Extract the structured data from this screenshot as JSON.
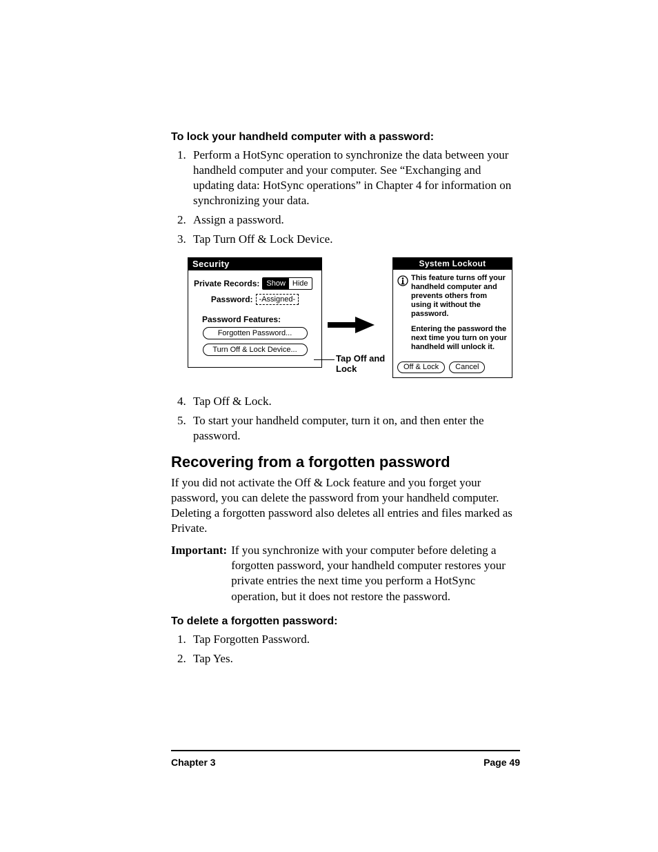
{
  "headings": {
    "lock_proc": "To lock your handheld computer with a password:",
    "recover": "Recovering from a forgotten password",
    "delete_proc": "To delete a forgotten password:"
  },
  "steps_lock": [
    "Perform a HotSync operation to synchronize the data between your handheld computer and your computer. See “Exchanging and updating data: HotSync operations” in Chapter 4 for information on synchronizing your data.",
    "Assign a password.",
    "Tap Turn Off & Lock Device."
  ],
  "steps_after": [
    "Tap Off & Lock.",
    "To start your handheld computer, turn it on, and then enter the password."
  ],
  "security_panel": {
    "title": "Security",
    "private_records_label": "Private Records:",
    "toggle_show": "Show",
    "toggle_hide": "Hide",
    "password_label": "Password:",
    "password_value": "-Assigned-",
    "features_label": "Password Features:",
    "btn_forgotten": "Forgotten Password...",
    "btn_turnoff": "Turn Off & Lock Device..."
  },
  "callout": "Tap Off and Lock",
  "lockout_panel": {
    "title": "System Lockout",
    "para1": "This feature turns off your handheld computer and prevents others from using it without the password.",
    "para2": "Entering the password the next time you turn on your handheld will unlock it.",
    "btn_offlock": "Off & Lock",
    "btn_cancel": "Cancel"
  },
  "recover_para": "If you did not activate the Off & Lock feature and you forget your password, you can delete the password from your handheld computer. Deleting a forgotten password also deletes all entries and files marked as Private.",
  "important_label": "Important:",
  "important_text": "If you synchronize with your computer before deleting a forgotten password, your handheld computer restores your private entries the next time you perform a HotSync operation, but it does not restore the password.",
  "steps_delete": [
    "Tap Forgotten Password.",
    "Tap Yes."
  ],
  "footer": {
    "chapter": "Chapter 3",
    "page": "Page 49"
  }
}
